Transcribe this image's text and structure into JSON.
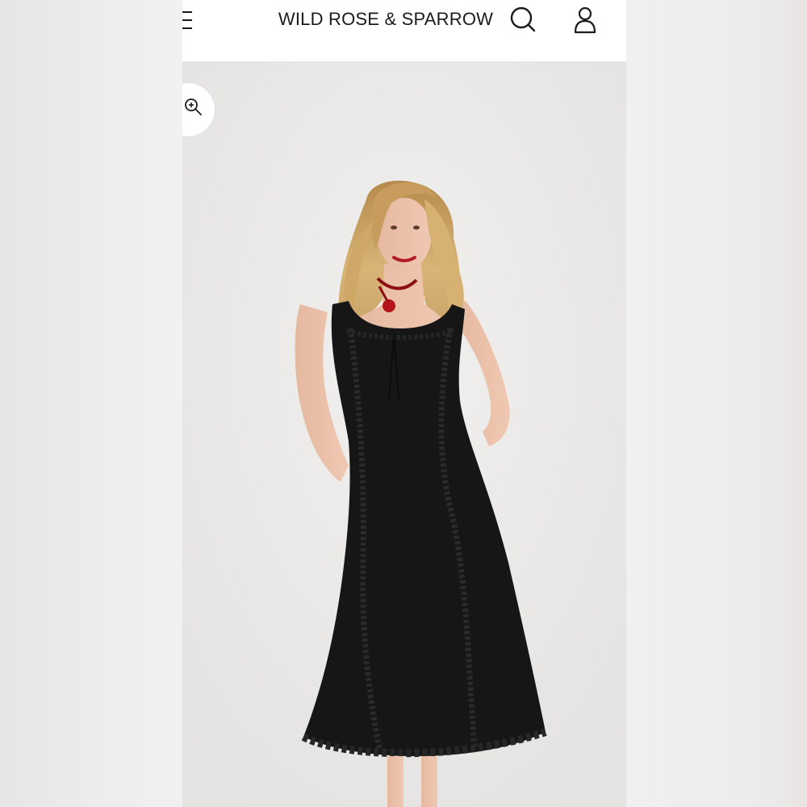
{
  "header": {
    "menu_icon": "hamburger-menu-icon",
    "brand": "WILD ROSE & SPARROW",
    "search_icon": "search-icon",
    "account_icon": "user-account-icon"
  },
  "gallery": {
    "zoom_icon": "zoom-in-icon",
    "image": "product-photo-black-ruffle-midi-dress"
  },
  "colors": {
    "header_bg": "#ffffff",
    "text": "#1b1b1b",
    "backdrop": "#ececec",
    "dress": "#161616",
    "necklace": "#b3151b"
  }
}
